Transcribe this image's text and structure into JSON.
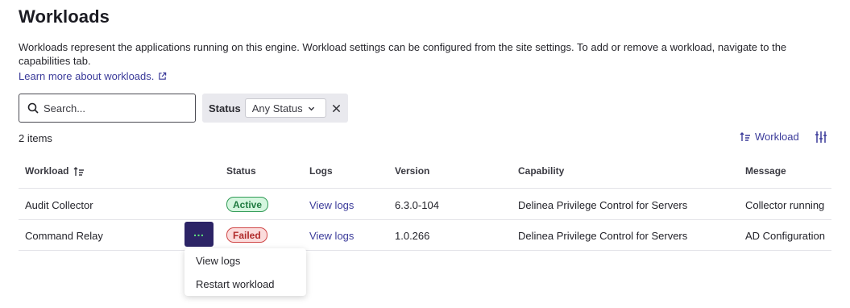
{
  "header": {
    "title": "Workloads",
    "description": "Workloads represent the applications running on this engine. Workload settings can be configured from the site settings. To add or remove a workload, navigate to the capabilities tab.",
    "learn_more": "Learn more about workloads."
  },
  "search": {
    "placeholder": "Search..."
  },
  "filter": {
    "label": "Status",
    "value": "Any Status"
  },
  "toolbar": {
    "item_count": "2 items",
    "sort_label": "Workload"
  },
  "table": {
    "columns": [
      "Workload",
      "Status",
      "Logs",
      "Version",
      "Capability",
      "Message"
    ],
    "rows": [
      {
        "workload": "Audit Collector",
        "status": "Active",
        "logs": "View logs",
        "version": "6.3.0-104",
        "capability": "Delinea Privilege Control for Servers",
        "message": "Collector running"
      },
      {
        "workload": "Command Relay",
        "status": "Failed",
        "logs": "View logs",
        "version": "1.0.266",
        "capability": "Delinea Privilege Control for Servers",
        "message": "AD Configuration"
      }
    ]
  },
  "actions_button": {
    "label": "…"
  },
  "context_menu": {
    "items": [
      "View logs",
      "Restart workload"
    ]
  },
  "colors": {
    "accent": "#3b3b9a",
    "actions_button_bg": "#2c2466",
    "active_badge": "#d5f6df",
    "failed_badge": "#fbdcdc"
  }
}
